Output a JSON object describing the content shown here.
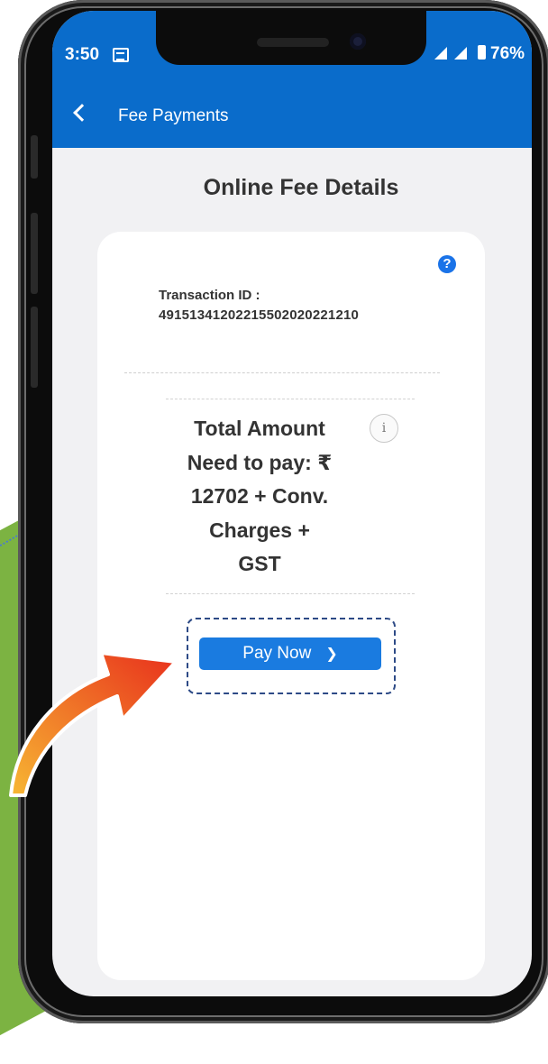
{
  "status_bar": {
    "time": "3:50",
    "battery": "76%",
    "icons": [
      "message-icon",
      "signal-icon",
      "battery-icon"
    ]
  },
  "app_bar": {
    "title": "Fee Payments",
    "back_icon": "chevron-left-icon"
  },
  "page": {
    "title": "Online Fee Details"
  },
  "card": {
    "transaction_label": "Transaction ID :",
    "transaction_id": "491513412022155020202212​10",
    "amount_lines": [
      "Total Amount",
      "Need to pay: ₹",
      "12702 + Conv.",
      "Charges +",
      "GST"
    ],
    "pay_button_label": "Pay Now",
    "help_icon": "question-circle-icon",
    "info_icon": "info-circle-icon"
  },
  "colors": {
    "app_bar": "#0a6ccb",
    "button": "#1a7be0",
    "background": "#f1f1f3",
    "decor_green": "#7cb342",
    "arrow_orange": "#f39c12"
  }
}
